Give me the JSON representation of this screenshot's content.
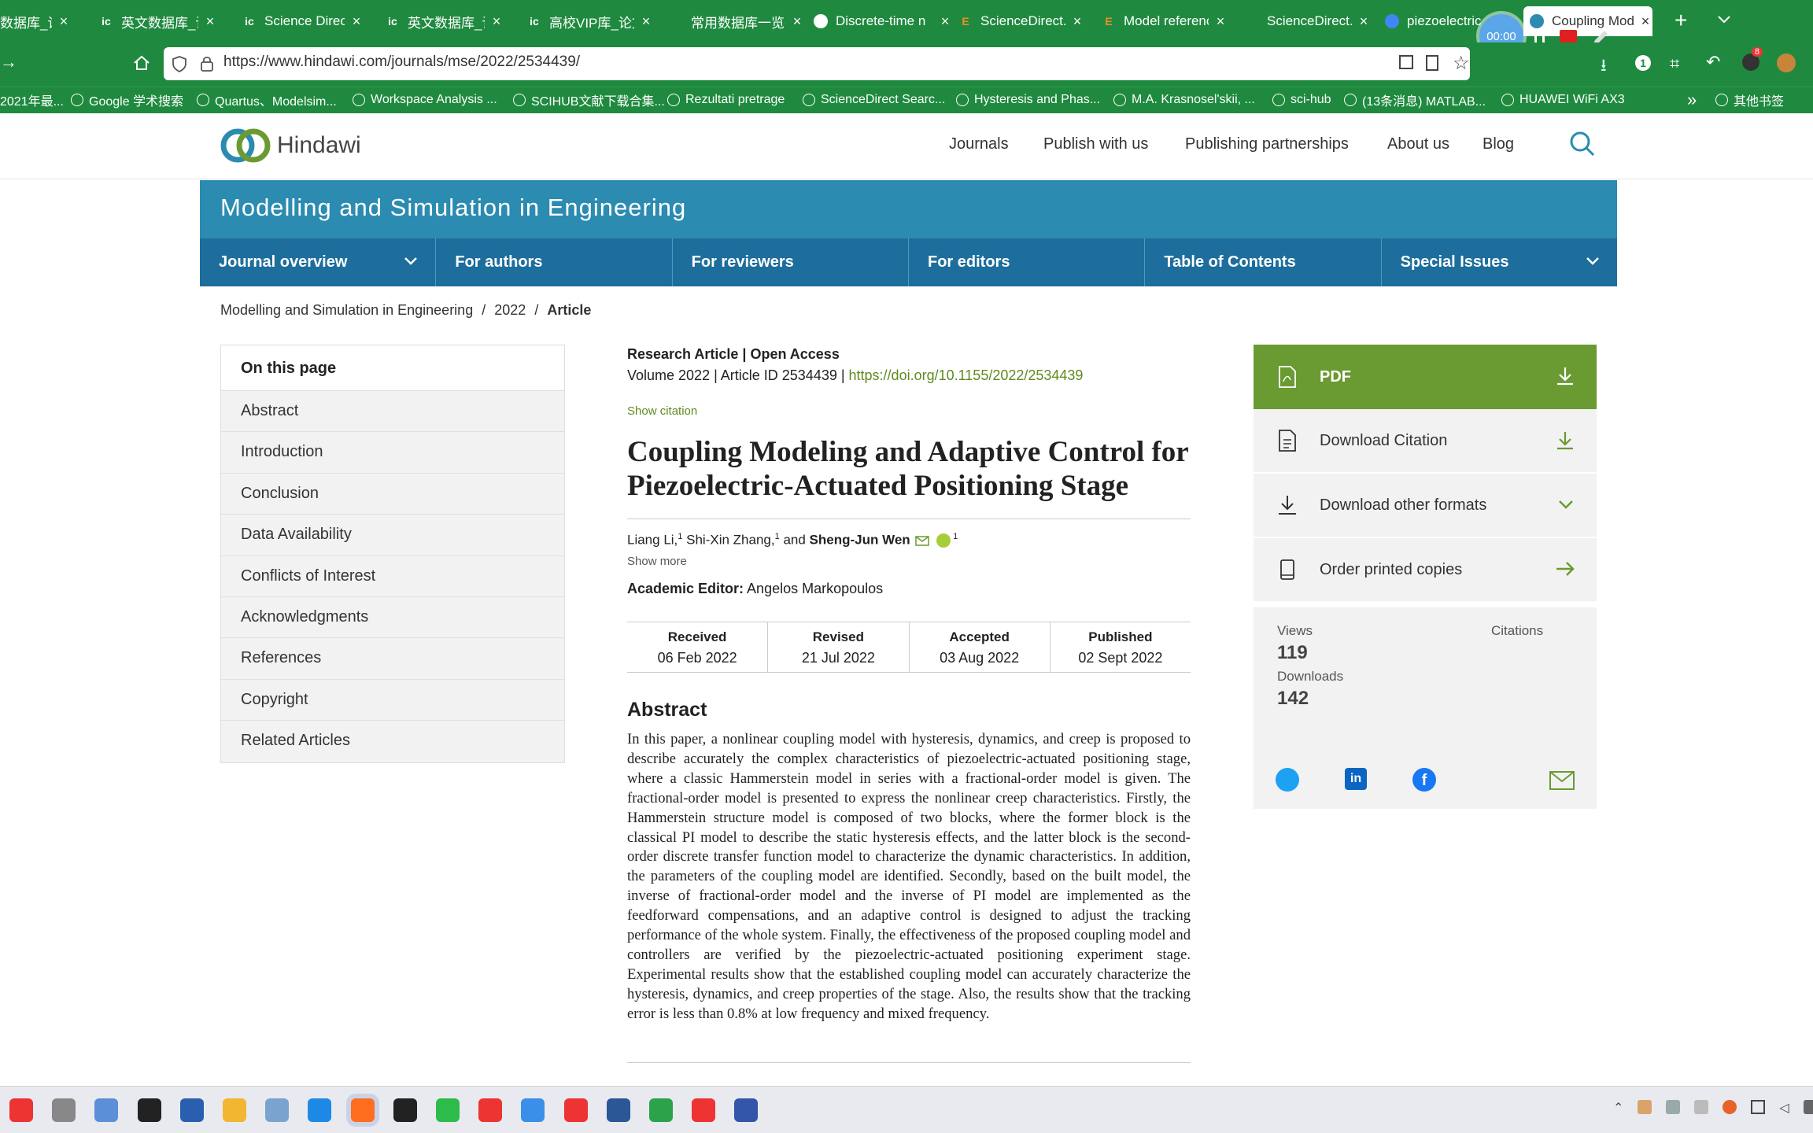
{
  "browser": {
    "tabs": [
      {
        "label": "数据库_论文",
        "icon": "ic-icon"
      },
      {
        "label": "英文数据库_论文",
        "icon": "ic-icon"
      },
      {
        "label": "Science Direct",
        "icon": "ic-icon"
      },
      {
        "label": "英文数据库_论文",
        "icon": "ic-icon"
      },
      {
        "label": "高校VIP库_论文",
        "icon": "ic-icon"
      },
      {
        "label": "常用数据库一览-vip",
        "icon": "blank-icon"
      },
      {
        "label": "Discrete-time n",
        "icon": "doc-icon"
      },
      {
        "label": "ScienceDirect.c",
        "icon": "elsevier-icon"
      },
      {
        "label": "Model referenc",
        "icon": "elsevier-icon"
      },
      {
        "label": "ScienceDirect.c",
        "icon": "blank-icon"
      },
      {
        "label": "piezoelectric",
        "icon": "scholar-icon"
      },
      {
        "label": "Coupling Mode",
        "icon": "hindawi-icon"
      }
    ],
    "recorder_time": "00:00",
    "url": "https://www.hindawi.com/journals/mse/2022/2534439/",
    "bookmarks": [
      "2021年最...",
      "Google 学术搜索",
      "Quartus、Modelsim...",
      "Workspace Analysis ...",
      "SCIHUB文献下载合集...",
      "Rezultati pretrage",
      "ScienceDirect Searc...",
      "Hysteresis and Phas...",
      "M.A. Krasnosel'skii, ...",
      "sci-hub",
      "(13条消息) MATLAB...",
      "HUAWEI WiFi AX3",
      "其他书签"
    ],
    "ext_badge": "8"
  },
  "site": {
    "logo_text": "Hindawi",
    "nav": [
      "Journals",
      "Publish with us",
      "Publishing partnerships",
      "About us",
      "Blog"
    ],
    "journal_title": "Modelling and Simulation in Engineering",
    "journal_nav": [
      "Journal overview",
      "For authors",
      "For reviewers",
      "For editors",
      "Table of Contents",
      "Special Issues"
    ],
    "breadcrumb": {
      "journal": "Modelling and Simulation in Engineering",
      "sep": "/",
      "year": "2022",
      "current": "Article"
    }
  },
  "toc": {
    "heading": "On this page",
    "items": [
      "Abstract",
      "Introduction",
      "Conclusion",
      "Data Availability",
      "Conflicts of Interest",
      "Acknowledgments",
      "References",
      "Copyright",
      "Related Articles"
    ]
  },
  "article": {
    "type": "Research Article | Open Access",
    "meta": "Volume 2022 | Article ID 2534439 | ",
    "doi": "https://doi.org/10.1155/2022/2534439",
    "show_citation": "Show citation",
    "title": "Coupling Modeling and Adaptive Control for Piezoelectric-Actuated Positioning Stage",
    "authors": {
      "a1": "Liang Li,",
      "a1_sup": "1",
      "a2": " Shi-Xin Zhang,",
      "a2_sup": "1",
      "and": " and ",
      "a3": "Sheng-Jun Wen",
      "a3_sup": "1"
    },
    "show_more": "Show more",
    "editor_label": "Academic Editor:",
    "editor": " Angelos Markopoulos",
    "dates": [
      {
        "label": "Received",
        "value": "06 Feb 2022"
      },
      {
        "label": "Revised",
        "value": "21 Jul 2022"
      },
      {
        "label": "Accepted",
        "value": "03 Aug 2022"
      },
      {
        "label": "Published",
        "value": "02 Sept 2022"
      }
    ],
    "abstract_heading": "Abstract",
    "abstract": "In this paper, a nonlinear coupling model with hysteresis, dynamics, and creep is proposed to describe accurately the complex characteristics of piezoelectric-actuated positioning stage, where a classic Hammerstein model in series with a fractional-order model is given. The fractional-order model is presented to express the nonlinear creep characteristics. Firstly, the Hammerstein structure model is composed of two blocks, where the former block is the classical PI model to describe the static hysteresis effects, and the latter block is the second-order discrete transfer function model to characterize the dynamic characteristics. In addition, the parameters of the coupling model are identified. Secondly, based on the built model, the inverse of fractional-order model and the inverse of PI model are implemented as the feedforward compensations, and an adaptive control is designed to adjust the tracking performance of the whole system. Finally, the effectiveness of the proposed coupling model and controllers are verified by the piezoelectric-actuated positioning experiment stage. Experimental results show that the established coupling model can accurately characterize the hysteresis, dynamics, and creep properties of the stage. Also, the results show that the tracking error is less than 0.8% at low frequency and mixed frequency."
  },
  "sidebar": {
    "pdf": "PDF",
    "download_citation": "Download Citation",
    "download_other": "Download other formats",
    "order_printed": "Order printed copies",
    "views_label": "Views",
    "views": "119",
    "citations_label": "Citations",
    "downloads_label": "Downloads",
    "downloads": "142"
  },
  "colors": {
    "browser_green": "#1f8a3f",
    "journal_blue": "#2b8bb0",
    "nav_blue": "#1d6e9c",
    "pdf_green": "#6a9a32",
    "link_green": "#5e8a1e"
  }
}
